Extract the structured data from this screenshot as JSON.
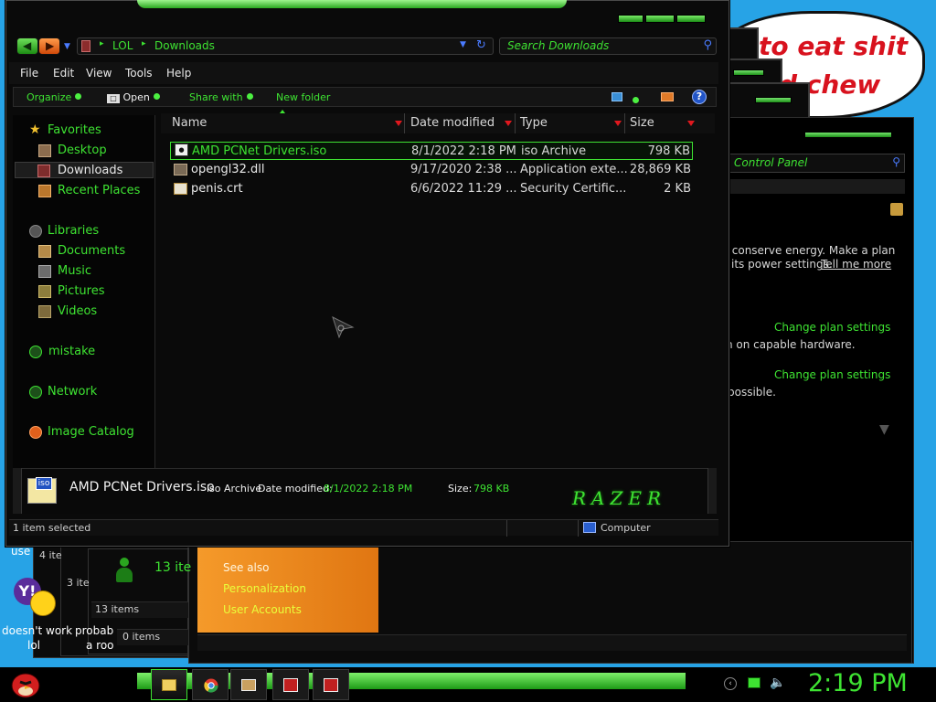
{
  "colors": {
    "accent": "#3ee332",
    "danger": "#e0181e",
    "window_bg": "#0a0a0a",
    "desktop": "#27a3e6"
  },
  "desktop": {
    "speech_bubble": {
      "line1": "to eat shit",
      "line2": "d chew"
    },
    "icon_labels": {
      "use": "use",
      "doesnt_work": "doesn't work",
      "lol": "lol",
      "probably": "probab",
      "a_roo": "a roo"
    },
    "bg_windows": {
      "count1": "4 ite",
      "count2": "3 ite",
      "count3": "13 ite",
      "count4": "13 items",
      "count5": "0 items"
    },
    "control_panel": {
      "search_placeholder": "Control Panel",
      "text1a": "r conserve energy. Make a plan",
      "text1b": "its power settings.",
      "tell_me_more": "Tell me more",
      "link1": "Change plan settings",
      "text2": "n on capable hardware.",
      "link2": "Change plan settings",
      "text3": "possible."
    },
    "orange_panel": {
      "see_also": "See also",
      "personalization": "Personalization",
      "user_accounts": "User Accounts"
    }
  },
  "explorer": {
    "breadcrumb": {
      "root": "LOL",
      "current": "Downloads"
    },
    "search_placeholder": "Search Downloads",
    "menu": {
      "file": "File",
      "edit": "Edit",
      "view": "View",
      "tools": "Tools",
      "help": "Help"
    },
    "toolbar": {
      "organize": "Organize",
      "open": "Open",
      "share_with": "Share with",
      "new_folder": "New folder",
      "help_icon": "?"
    },
    "nav": {
      "favorites": "Favorites",
      "desktop": "Desktop",
      "downloads": "Downloads",
      "recent_places": "Recent Places",
      "libraries": "Libraries",
      "documents": "Documents",
      "music": "Music",
      "pictures": "Pictures",
      "videos": "Videos",
      "mistake": "mistake",
      "network": "Network",
      "image_catalog": "Image Catalog"
    },
    "columns": {
      "name": "Name",
      "date_modified": "Date modified",
      "type": "Type",
      "size": "Size"
    },
    "files": [
      {
        "name": "AMD PCNet Drivers.iso",
        "date": "8/1/2022 2:18 PM",
        "type": "iso Archive",
        "size": "798 KB",
        "icon": "iso-icon"
      },
      {
        "name": "opengl32.dll",
        "date": "9/17/2020 2:38 ...",
        "type": "Application exte...",
        "size": "28,869 KB",
        "icon": "dll-icon"
      },
      {
        "name": "penis.crt",
        "date": "6/6/2022 11:29 ...",
        "type": "Security Certific...",
        "size": "2 KB",
        "icon": "certificate-icon"
      }
    ],
    "details": {
      "icon_label": "iso",
      "filename": "AMD PCNet Drivers.iso",
      "type": "iso Archive",
      "date_label": "Date modified:",
      "date_value": "8/1/2022 2:18 PM",
      "size_label": "Size:",
      "size_value": "798 KB",
      "logo": "RAZER"
    },
    "status": {
      "selected": "1 item selected",
      "location": "Computer"
    }
  },
  "taskbar": {
    "clock": "2:19 PM"
  }
}
